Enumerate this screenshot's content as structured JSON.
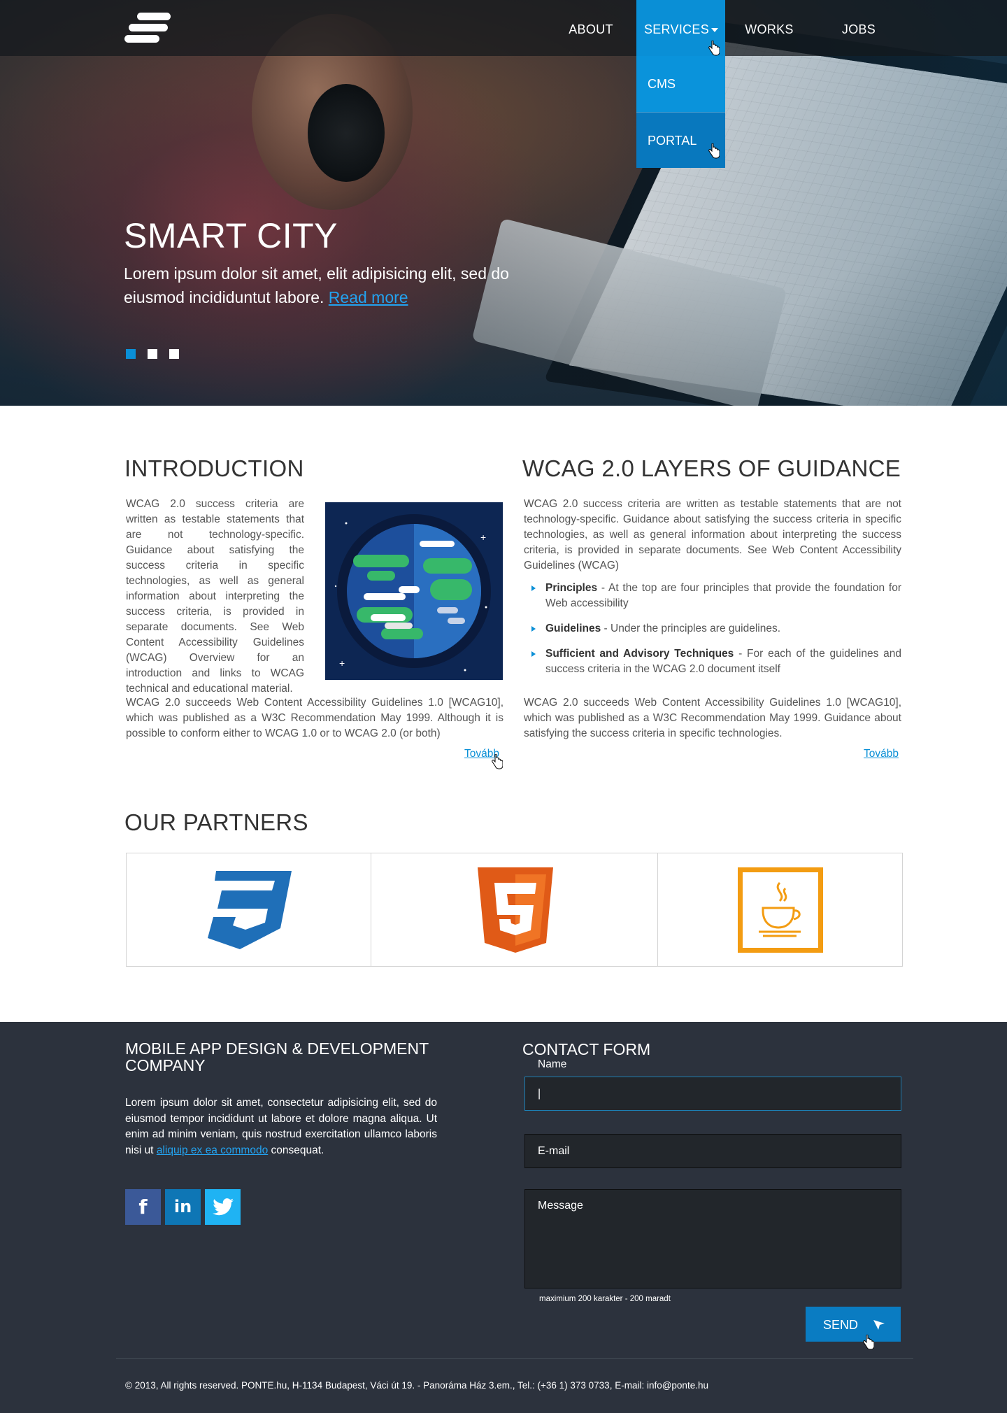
{
  "nav": {
    "items": [
      "ABOUT",
      "SERVICES",
      "WORKS",
      "JOBS"
    ],
    "dropdown": [
      "CMS",
      "PORTAL"
    ]
  },
  "hero": {
    "title": "SMART CITY",
    "text": "Lorem ipsum dolor sit amet, elit adipisicing elit, sed do eiusmod incididuntut labore.",
    "link": "Read more",
    "slides": 3,
    "active_slide": 1
  },
  "intro": {
    "title": "INTRODUCTION",
    "text1": "WCAG 2.0 success criteria are written as testable statements that are not technology-specific. Guidance about satisfying the success criteria in specific technologies, as well as general information about interpreting the success criteria, is provided in separate documents. See Web Content Accessibility Guidelines (WCAG) Overview for an introduction and links to WCAG technical and educational material.",
    "text2": "WCAG 2.0 succeeds Web Content Accessibility Guidelines 1.0 [WCAG10], which was published as a W3C Recommendation May 1999. Although it is possible to conform either to WCAG 1.0 or to WCAG 2.0 (or both)",
    "more": "Tovább"
  },
  "wcag": {
    "title": "WCAG 2.0 LAYERS OF GUIDANCE",
    "text1": "WCAG 2.0 success criteria are written as testable statements that are not technology-specific. Guidance about satisfying the success criteria in specific technologies, as well as general information about interpreting the success criteria, is provided in separate documents. See Web Content Accessibility Guidelines (WCAG)",
    "list": [
      {
        "term": "Principles",
        "desc": " - At the top are four principles that provide the foundation for Web accessibility"
      },
      {
        "term": "Guidelines",
        "desc": " - Under the principles are guidelines."
      },
      {
        "term": "Sufficient and Advisory Techniques",
        "desc": " - For each of the guidelines and success criteria in the WCAG 2.0 document itself"
      }
    ],
    "text2": "WCAG 2.0 succeeds Web Content Accessibility Guidelines 1.0 [WCAG10], which was published as a W3C Recommendation May 1999. Guidance about satisfying the success criteria in specific technologies.",
    "more": "Tovább"
  },
  "partners": {
    "title": "OUR PARTNERS",
    "logos": [
      "css3-logo",
      "html5-logo",
      "java-logo"
    ]
  },
  "footer": {
    "company_title": "MOBILE APP DESIGN & DEVELOPMENT COMPANY",
    "company_text_before": "Lorem ipsum dolor sit amet, consectetur adipisicing elit, sed do eiusmod tempor incididunt ut labore et dolore magna aliqua. Ut enim ad minim veniam, quis nostrud exercitation ullamco laboris nisi ut ",
    "company_link": "aliquip ex ea commodo",
    "company_text_after": " consequat.",
    "social": [
      "f",
      "in",
      "twitter"
    ],
    "contact_title": "CONTACT FORM",
    "name_label": "Name",
    "name_value": "|",
    "email_placeholder": "E-mail",
    "message_placeholder": "Message",
    "counter": "maximium 200 karakter - 200 maradt",
    "send": "SEND",
    "copyright": "© 2013, All rights reserved. PONTE.hu, H-1134 Budapest, Váci út 19. - Panoráma Ház 3.em.,  Tel.: (+36 1) 373 0733,  E-mail: info@ponte.hu"
  },
  "colors": {
    "accent": "#0a8fd6",
    "footer_bg": "#2c323d",
    "facebook": "#3b5998",
    "linkedin": "#0e76b5",
    "twitter": "#1fb3f3"
  }
}
